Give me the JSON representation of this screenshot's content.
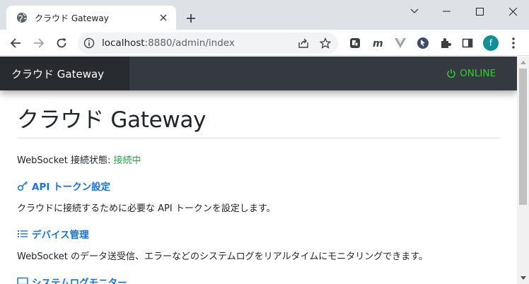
{
  "browser": {
    "tab_title": "クラウド Gateway",
    "url_host": "localhost",
    "url_rest": ":8880/admin/index",
    "profile_initial": "f"
  },
  "navbar": {
    "brand": "クラウド Gateway",
    "status_label": "ONLINE",
    "status_color": "#2ed02e"
  },
  "page": {
    "title": "クラウド Gateway",
    "ws_label": "WebSocket 接続状態: ",
    "ws_status": "接続中",
    "sections": [
      {
        "label": "API トークン設定",
        "icon": "key-icon",
        "description": "クラウドに接続するために必要な API トークンを設定します。"
      },
      {
        "label": "デバイス管理",
        "icon": "list-icon",
        "description": "WebSocket のデータ送受信、エラーなどのシステムログをリアルタイムにモニタリングできます。"
      },
      {
        "label": "システムログモニター",
        "icon": "monitor-icon"
      }
    ]
  },
  "colors": {
    "link": "#1473e6",
    "navbar": "#343a40",
    "brand_bg": "#272b30",
    "ok_text": "#28a745"
  }
}
